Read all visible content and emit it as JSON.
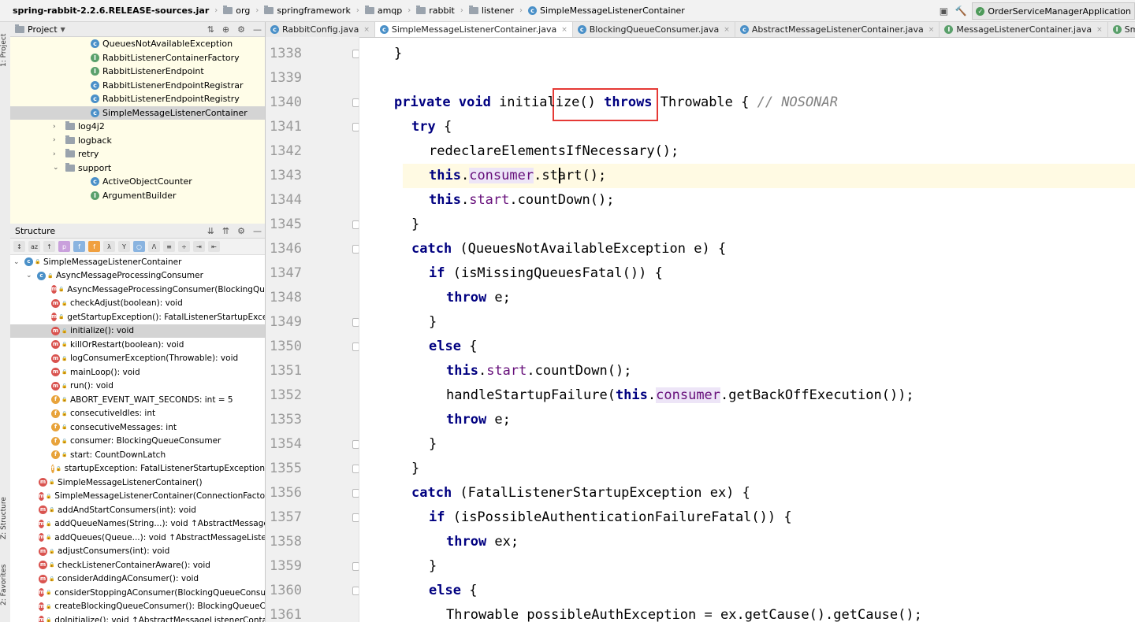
{
  "breadcrumb": [
    {
      "label": "spring-rabbit-2.2.6.RELEASE-sources.jar",
      "icon": "jar-icon"
    },
    {
      "label": "org",
      "icon": "folder-icon"
    },
    {
      "label": "springframework",
      "icon": "folder-icon"
    },
    {
      "label": "amqp",
      "icon": "folder-icon"
    },
    {
      "label": "rabbit",
      "icon": "folder-icon"
    },
    {
      "label": "listener",
      "icon": "folder-icon"
    },
    {
      "label": "SimpleMessageListenerContainer",
      "icon": "class-icon"
    }
  ],
  "run_config": "OrderServiceManagerApplication",
  "side_stripe": {
    "project": "1: Project",
    "structure": "Z: Structure",
    "favorites": "2: Favorites"
  },
  "project_panel": {
    "title": "Project",
    "items": [
      {
        "label": "QueuesNotAvailableException",
        "indent": 102,
        "kind": "class"
      },
      {
        "label": "RabbitListenerContainerFactory",
        "indent": 102,
        "kind": "iface"
      },
      {
        "label": "RabbitListenerEndpoint",
        "indent": 102,
        "kind": "iface"
      },
      {
        "label": "RabbitListenerEndpointRegistrar",
        "indent": 102,
        "kind": "class"
      },
      {
        "label": "RabbitListenerEndpointRegistry",
        "indent": 102,
        "kind": "class"
      },
      {
        "label": "SimpleMessageListenerContainer",
        "indent": 102,
        "kind": "class",
        "selected": true
      },
      {
        "label": "log4j2",
        "indent": 70,
        "kind": "folder",
        "arrow": ">"
      },
      {
        "label": "logback",
        "indent": 70,
        "kind": "folder",
        "arrow": ">"
      },
      {
        "label": "retry",
        "indent": 70,
        "kind": "folder",
        "arrow": ">"
      },
      {
        "label": "support",
        "indent": 70,
        "kind": "folder",
        "arrow": "v"
      },
      {
        "label": "ActiveObjectCounter",
        "indent": 102,
        "kind": "class"
      },
      {
        "label": "ArgumentBuilder",
        "indent": 102,
        "kind": "iface"
      }
    ]
  },
  "structure_panel": {
    "title": "Structure",
    "items": [
      {
        "label": "SimpleMessageListenerContainer",
        "indent": 4,
        "icon": "c",
        "arrow": "v"
      },
      {
        "label": "AsyncMessageProcessingConsumer",
        "indent": 20,
        "icon": "c",
        "arrow": "v"
      },
      {
        "label": "AsyncMessageProcessingConsumer(BlockingQueu",
        "indent": 52,
        "icon": "m"
      },
      {
        "label": "checkAdjust(boolean): void",
        "indent": 52,
        "icon": "m"
      },
      {
        "label": "getStartupException(): FatalListenerStartupExceptic",
        "indent": 52,
        "icon": "m"
      },
      {
        "label": "initialize(): void",
        "indent": 52,
        "icon": "m",
        "selected": true
      },
      {
        "label": "killOrRestart(boolean): void",
        "indent": 52,
        "icon": "m"
      },
      {
        "label": "logConsumerException(Throwable): void",
        "indent": 52,
        "icon": "m"
      },
      {
        "label": "mainLoop(): void",
        "indent": 52,
        "icon": "m"
      },
      {
        "label": "run(): void",
        "indent": 52,
        "icon": "m"
      },
      {
        "label": "ABORT_EVENT_WAIT_SECONDS: int = 5",
        "indent": 52,
        "icon": "f"
      },
      {
        "label": "consecutiveIdles: int",
        "indent": 52,
        "icon": "f"
      },
      {
        "label": "consecutiveMessages: int",
        "indent": 52,
        "icon": "f"
      },
      {
        "label": "consumer: BlockingQueueConsumer",
        "indent": 52,
        "icon": "f"
      },
      {
        "label": "start: CountDownLatch",
        "indent": 52,
        "icon": "f"
      },
      {
        "label": "startupException: FatalListenerStartupException",
        "indent": 52,
        "icon": "f"
      },
      {
        "label": "SimpleMessageListenerContainer()",
        "indent": 36,
        "icon": "m"
      },
      {
        "label": "SimpleMessageListenerContainer(ConnectionFactory)",
        "indent": 36,
        "icon": "m"
      },
      {
        "label": "addAndStartConsumers(int): void",
        "indent": 36,
        "icon": "m"
      },
      {
        "label": "addQueueNames(String...): void ↑AbstractMessageLis",
        "indent": 36,
        "icon": "m"
      },
      {
        "label": "addQueues(Queue...): void ↑AbstractMessageListener",
        "indent": 36,
        "icon": "m"
      },
      {
        "label": "adjustConsumers(int): void",
        "indent": 36,
        "icon": "m"
      },
      {
        "label": "checkListenerContainerAware(): void",
        "indent": 36,
        "icon": "m"
      },
      {
        "label": "considerAddingAConsumer(): void",
        "indent": 36,
        "icon": "m"
      },
      {
        "label": "considerStoppingAConsumer(BlockingQueueConsume",
        "indent": 36,
        "icon": "m"
      },
      {
        "label": "createBlockingQueueConsumer(): BlockingQueueCons",
        "indent": 36,
        "icon": "m"
      },
      {
        "label": "doInitialize(): void ↑AbstractMessageListenerContaine",
        "indent": 36,
        "icon": "m"
      }
    ]
  },
  "editor_tabs": [
    {
      "label": "RabbitConfig.java",
      "icon": "c"
    },
    {
      "label": "SimpleMessageListenerContainer.java",
      "icon": "c",
      "active": true
    },
    {
      "label": "BlockingQueueConsumer.java",
      "icon": "c"
    },
    {
      "label": "AbstractMessageListenerContainer.java",
      "icon": "c"
    },
    {
      "label": "MessageListenerContainer.java",
      "icon": "i"
    },
    {
      "label": "SmartLifecycle.java",
      "icon": "i"
    }
  ],
  "code": {
    "highlight_line": 5,
    "lines": [
      {
        "n": "1338",
        "indent": 2,
        "tokens": [
          {
            "t": "}",
            "c": ""
          }
        ]
      },
      {
        "n": "1339",
        "indent": 0,
        "tokens": []
      },
      {
        "n": "1340",
        "indent": 2,
        "tokens": [
          {
            "t": "private void ",
            "c": "kw"
          },
          {
            "t": "initialize() ",
            "c": ""
          },
          {
            "t": "throws ",
            "c": "kw"
          },
          {
            "t": "Throwable { ",
            "c": ""
          },
          {
            "t": "// NOSONAR",
            "c": "cmt"
          }
        ]
      },
      {
        "n": "1341",
        "indent": 3,
        "tokens": [
          {
            "t": "try ",
            "c": "kw"
          },
          {
            "t": "{",
            "c": ""
          }
        ]
      },
      {
        "n": "1342",
        "indent": 4,
        "tokens": [
          {
            "t": "redeclareElementsIfNecessary();",
            "c": ""
          }
        ]
      },
      {
        "n": "1343",
        "indent": 4,
        "tokens": [
          {
            "t": "this",
            "c": "kw"
          },
          {
            "t": ".",
            "c": ""
          },
          {
            "t": "consumer",
            "c": "fld usage"
          },
          {
            "t": ".start();",
            "c": ""
          }
        ]
      },
      {
        "n": "1344",
        "indent": 4,
        "tokens": [
          {
            "t": "this",
            "c": "kw"
          },
          {
            "t": ".",
            "c": ""
          },
          {
            "t": "start",
            "c": "fld"
          },
          {
            "t": ".countDown();",
            "c": ""
          }
        ]
      },
      {
        "n": "1345",
        "indent": 3,
        "tokens": [
          {
            "t": "}",
            "c": ""
          }
        ]
      },
      {
        "n": "1346",
        "indent": 3,
        "tokens": [
          {
            "t": "catch ",
            "c": "kw"
          },
          {
            "t": "(QueuesNotAvailableException e) {",
            "c": ""
          }
        ]
      },
      {
        "n": "1347",
        "indent": 4,
        "tokens": [
          {
            "t": "if ",
            "c": "kw"
          },
          {
            "t": "(isMissingQueuesFatal()) {",
            "c": ""
          }
        ]
      },
      {
        "n": "1348",
        "indent": 5,
        "tokens": [
          {
            "t": "throw ",
            "c": "kw"
          },
          {
            "t": "e;",
            "c": ""
          }
        ]
      },
      {
        "n": "1349",
        "indent": 4,
        "tokens": [
          {
            "t": "}",
            "c": ""
          }
        ]
      },
      {
        "n": "1350",
        "indent": 4,
        "tokens": [
          {
            "t": "else ",
            "c": "kw"
          },
          {
            "t": "{",
            "c": ""
          }
        ]
      },
      {
        "n": "1351",
        "indent": 5,
        "tokens": [
          {
            "t": "this",
            "c": "kw"
          },
          {
            "t": ".",
            "c": ""
          },
          {
            "t": "start",
            "c": "fld"
          },
          {
            "t": ".countDown();",
            "c": ""
          }
        ]
      },
      {
        "n": "1352",
        "indent": 5,
        "tokens": [
          {
            "t": "handleStartupFailure(",
            "c": ""
          },
          {
            "t": "this",
            "c": "kw"
          },
          {
            "t": ".",
            "c": ""
          },
          {
            "t": "consumer",
            "c": "fld usage"
          },
          {
            "t": ".getBackOffExecution());",
            "c": ""
          }
        ]
      },
      {
        "n": "1353",
        "indent": 5,
        "tokens": [
          {
            "t": "throw ",
            "c": "kw"
          },
          {
            "t": "e;",
            "c": ""
          }
        ]
      },
      {
        "n": "1354",
        "indent": 4,
        "tokens": [
          {
            "t": "}",
            "c": ""
          }
        ]
      },
      {
        "n": "1355",
        "indent": 3,
        "tokens": [
          {
            "t": "}",
            "c": ""
          }
        ]
      },
      {
        "n": "1356",
        "indent": 3,
        "tokens": [
          {
            "t": "catch ",
            "c": "kw"
          },
          {
            "t": "(FatalListenerStartupException ex) {",
            "c": ""
          }
        ]
      },
      {
        "n": "1357",
        "indent": 4,
        "tokens": [
          {
            "t": "if ",
            "c": "kw"
          },
          {
            "t": "(isPossibleAuthenticationFailureFatal()) {",
            "c": ""
          }
        ]
      },
      {
        "n": "1358",
        "indent": 5,
        "tokens": [
          {
            "t": "throw ",
            "c": "kw"
          },
          {
            "t": "ex;",
            "c": ""
          }
        ]
      },
      {
        "n": "1359",
        "indent": 4,
        "tokens": [
          {
            "t": "}",
            "c": ""
          }
        ]
      },
      {
        "n": "1360",
        "indent": 4,
        "tokens": [
          {
            "t": "else ",
            "c": "kw"
          },
          {
            "t": "{",
            "c": ""
          }
        ]
      },
      {
        "n": "1361",
        "indent": 5,
        "tokens": [
          {
            "t": "Throwable possibleAuthException = ex.getCause().getCause();",
            "c": ""
          }
        ]
      }
    ]
  }
}
